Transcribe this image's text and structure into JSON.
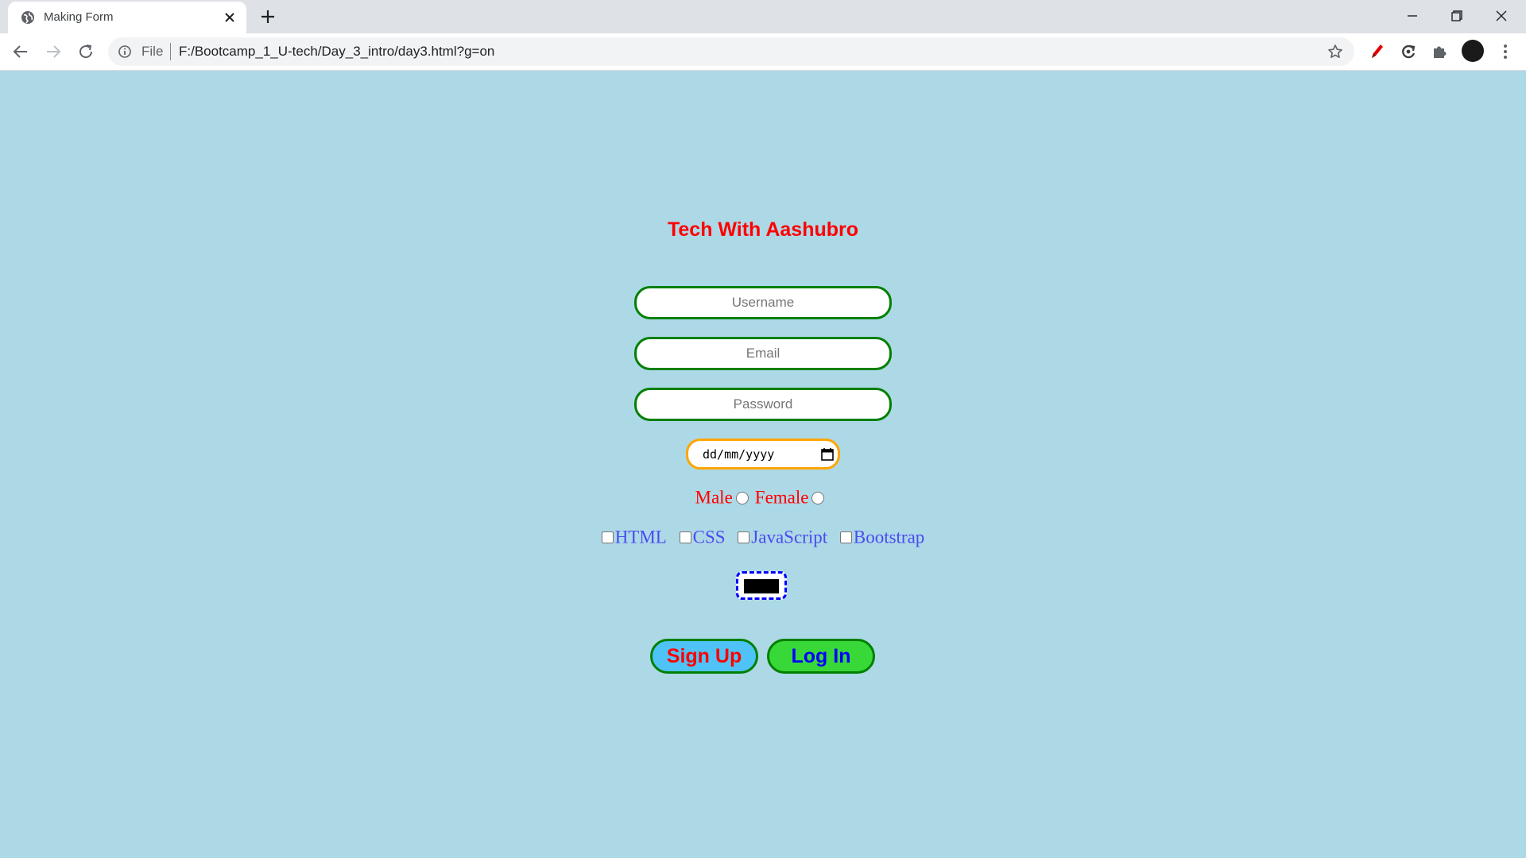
{
  "browser": {
    "tab_title": "Making Form",
    "omnibox": {
      "scheme_label": "File",
      "url": "F:/Bootcamp_1_U-tech/Day_3_intro/day3.html?g=on"
    }
  },
  "page": {
    "background": "#add8e6",
    "title": "Tech With Aashubro",
    "title_color": "#ff0000",
    "inputs": {
      "username_placeholder": "Username",
      "email_placeholder": "Email",
      "password_placeholder": "Password",
      "date_placeholder": "dd/mm/yyyy"
    },
    "gender": {
      "male_label": "Male",
      "female_label": "Female"
    },
    "skills": [
      "HTML",
      "CSS",
      "JavaScript",
      "Bootstrap"
    ],
    "color_value": "#000000",
    "buttons": {
      "signup_label": "Sign Up",
      "login_label": "Log In"
    }
  }
}
